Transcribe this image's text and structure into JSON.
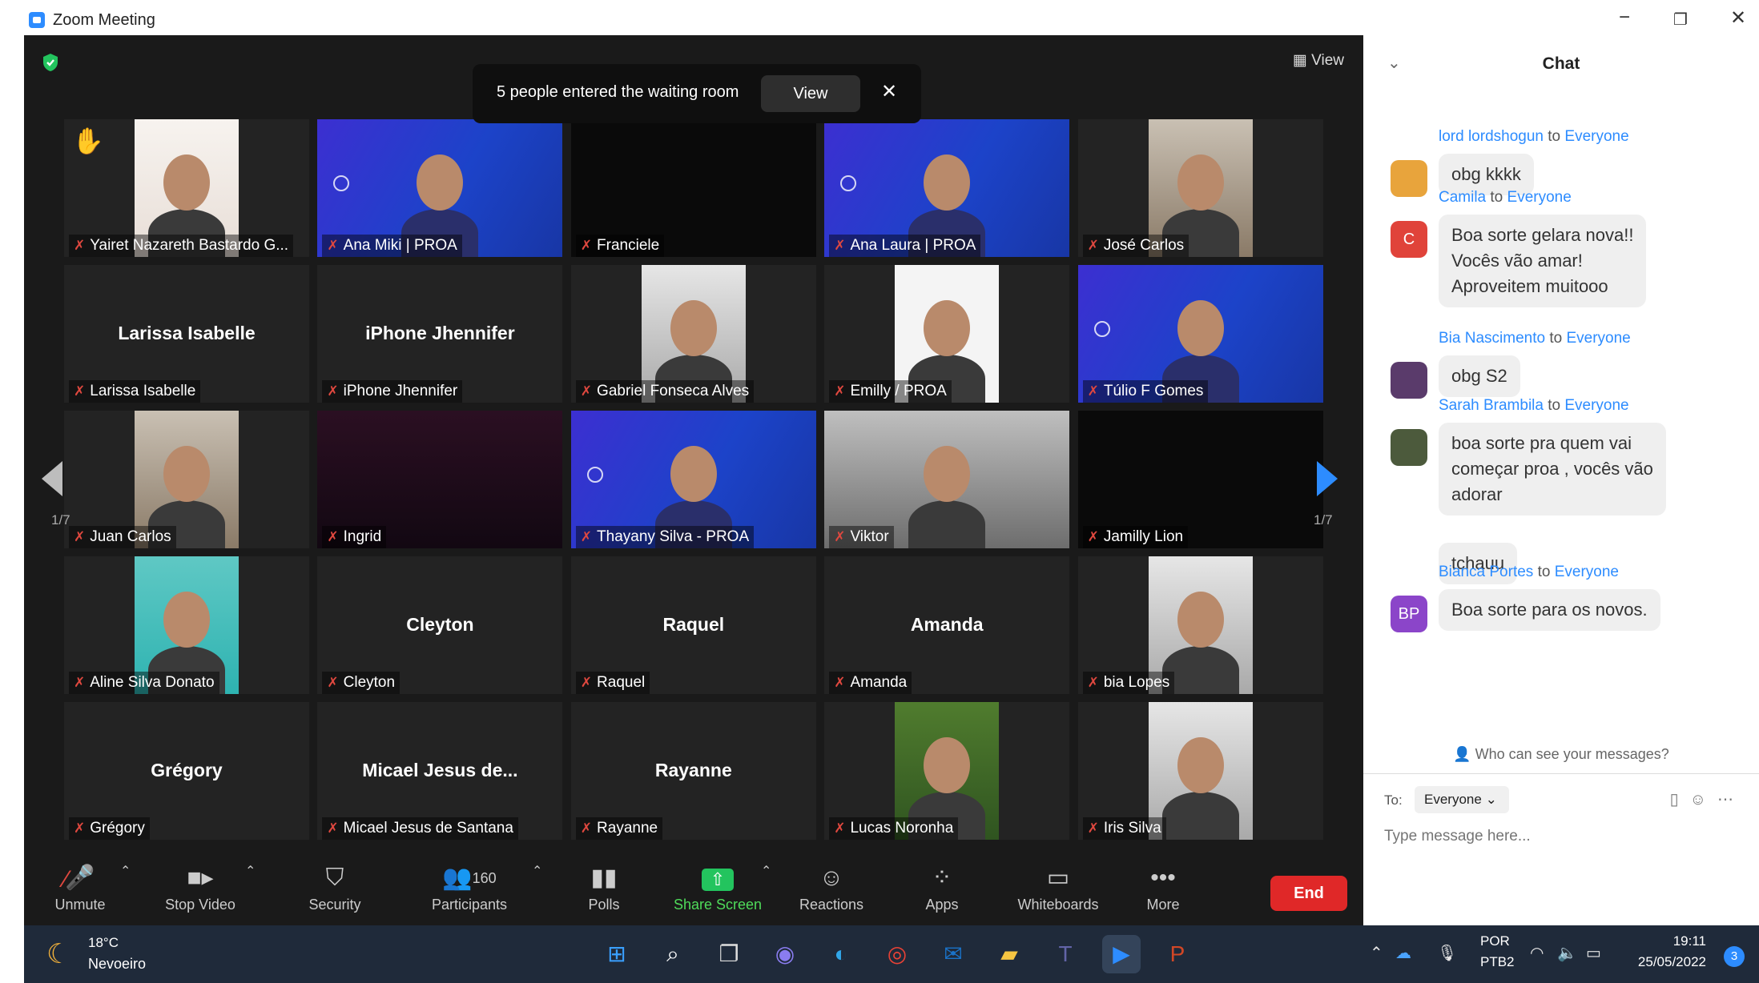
{
  "window": {
    "title": "Zoom Meeting",
    "minimize": "−",
    "maximize": "❐",
    "close": "✕"
  },
  "meeting": {
    "view_label": "View",
    "banner": {
      "text": "5 people entered the waiting room",
      "view": "View",
      "close": "✕"
    },
    "pager": "1/7",
    "tiles": [
      {
        "name": "Yairet Nazareth Bastardo G...",
        "video": "pink",
        "hand": true
      },
      {
        "name": "Ana Miki | PROA",
        "video": "blue"
      },
      {
        "name": "Franciele",
        "video": "dark"
      },
      {
        "name": "Ana Laura | PROA",
        "video": "blue"
      },
      {
        "name": "José Carlos",
        "video": "room"
      },
      {
        "name": "Larissa Isabelle",
        "big": "Larissa Isabelle"
      },
      {
        "name": "iPhone Jhennifer",
        "big": "iPhone Jhennifer"
      },
      {
        "name": "Gabriel Fonseca Alves",
        "video": "light"
      },
      {
        "name": "Emilly / PROA",
        "video": "white"
      },
      {
        "name": "Túlio F Gomes",
        "video": "blue"
      },
      {
        "name": "Juan Carlos",
        "video": "room"
      },
      {
        "name": "Ingrid",
        "video": "purple"
      },
      {
        "name": "Thayany Silva - PROA",
        "video": "blue",
        "active": true
      },
      {
        "name": "Viktor",
        "video": "gray"
      },
      {
        "name": "Jamilly Lion",
        "video": "dark"
      },
      {
        "name": "Aline Silva Donato",
        "video": "teal"
      },
      {
        "name": "Cleyton",
        "big": "Cleyton"
      },
      {
        "name": "Raquel",
        "big": "Raquel"
      },
      {
        "name": "Amanda",
        "big": "Amanda"
      },
      {
        "name": "bia Lopes",
        "video": "light"
      },
      {
        "name": "Grégory",
        "big": "Grégory"
      },
      {
        "name": "Micael Jesus de Santana",
        "big": "Micael Jesus de..."
      },
      {
        "name": "Rayanne",
        "big": "Rayanne"
      },
      {
        "name": "Lucas Noronha",
        "video": "green"
      },
      {
        "name": "Iris Silva",
        "video": "light"
      }
    ]
  },
  "toolbar": {
    "unmute": "Unmute",
    "stop_video": "Stop Video",
    "security": "Security",
    "participants": "Participants",
    "participants_count": "160",
    "polls": "Polls",
    "share_screen": "Share Screen",
    "reactions": "Reactions",
    "apps": "Apps",
    "whiteboards": "Whiteboards",
    "more": "More",
    "end": "End"
  },
  "chat": {
    "title": "Chat",
    "messages": [
      {
        "from": "lord lordshogun",
        "to": "Everyone",
        "text": "obg kkkk",
        "avatar": "",
        "avatar_color": "#e8a43c"
      },
      {
        "from": "Camila",
        "to": "Everyone",
        "text": "Boa sorte gelara nova!!\nVocês vão amar!\nAproveitem muitooo",
        "avatar": "C",
        "avatar_color": "#e0433a"
      },
      {
        "from": "Bia Nascimento",
        "to": "Everyone",
        "text": "obg S2",
        "avatar": "",
        "avatar_color": "#5a3b6b"
      },
      {
        "from": "Sarah Brambila",
        "to": "Everyone",
        "text": "boa sorte pra quem vai\ncomeçar  proa , vocês vão\nadorar",
        "text2": "tchauu",
        "avatar": "",
        "avatar_color": "#4c5a3c"
      },
      {
        "from": "Bianca Portes",
        "to": "Everyone",
        "text": "Boa sorte para os novos.",
        "avatar": "BP",
        "avatar_color": "#8b45c9"
      }
    ],
    "to_word": "to",
    "who_can_see": "Who can see your messages?",
    "to_label": "To:",
    "to_value": "Everyone",
    "placeholder": "Type message here..."
  },
  "taskbar": {
    "temp": "18°C",
    "weather": "Nevoeiro",
    "lang1": "POR",
    "lang2": "PTB2",
    "time": "19:11",
    "date": "25/05/2022",
    "notifications": "3"
  }
}
